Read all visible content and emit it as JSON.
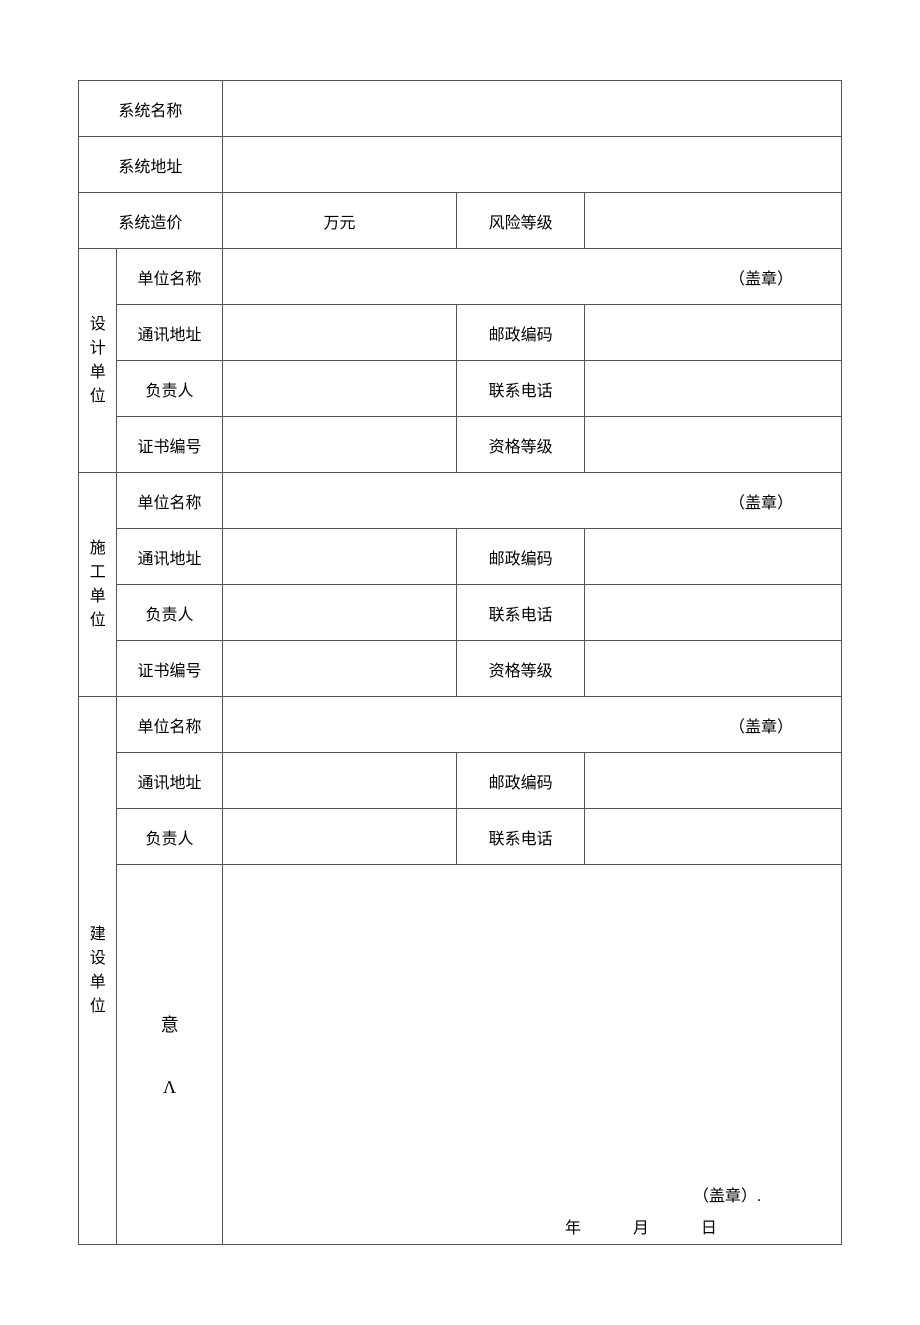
{
  "row1": {
    "system_name_label": "系统名称",
    "system_name_val": ""
  },
  "row2": {
    "system_addr_label": "系统地址",
    "system_addr_val": ""
  },
  "row3": {
    "system_cost_label": "系统造价",
    "unit": "万元",
    "risk_label": "风险等级",
    "risk_val": ""
  },
  "design": {
    "group_label": "设计单位",
    "name_label": "单位名称",
    "name_seal": "（盖章）",
    "addr_label": "通讯地址",
    "addr_val": "",
    "post_label": "邮政编码",
    "post_val": "",
    "leader_label": "负责人",
    "leader_val": "",
    "phone_label": "联系电话",
    "phone_val": "",
    "cert_label": "证书编号",
    "cert_val": "",
    "grade_label": "资格等级",
    "grade_val": ""
  },
  "construction": {
    "group_label": "施工单位",
    "name_label": "单位名称",
    "name_seal": "（盖章）",
    "addr_label": "通讯地址",
    "addr_val": "",
    "post_label": "邮政编码",
    "post_val": "",
    "leader_label": "负责人",
    "leader_val": "",
    "phone_label": "联系电话",
    "phone_val": "",
    "cert_label": "证书编号",
    "cert_val": "",
    "grade_label": "资格等级",
    "grade_val": ""
  },
  "build": {
    "group_label": "建设单位",
    "name_label": "单位名称",
    "name_seal": "（盖章）",
    "addr_label": "通讯地址",
    "addr_val": "",
    "post_label": "邮政编码",
    "post_val": "",
    "leader_label": "负责人",
    "leader_val": "",
    "phone_label": "联系电话",
    "phone_val": "",
    "opinion_char1": "意",
    "opinion_char2": "Λ",
    "seal_line": "（盖章）.",
    "date_y": "年",
    "date_m": "月",
    "date_d": "日"
  }
}
